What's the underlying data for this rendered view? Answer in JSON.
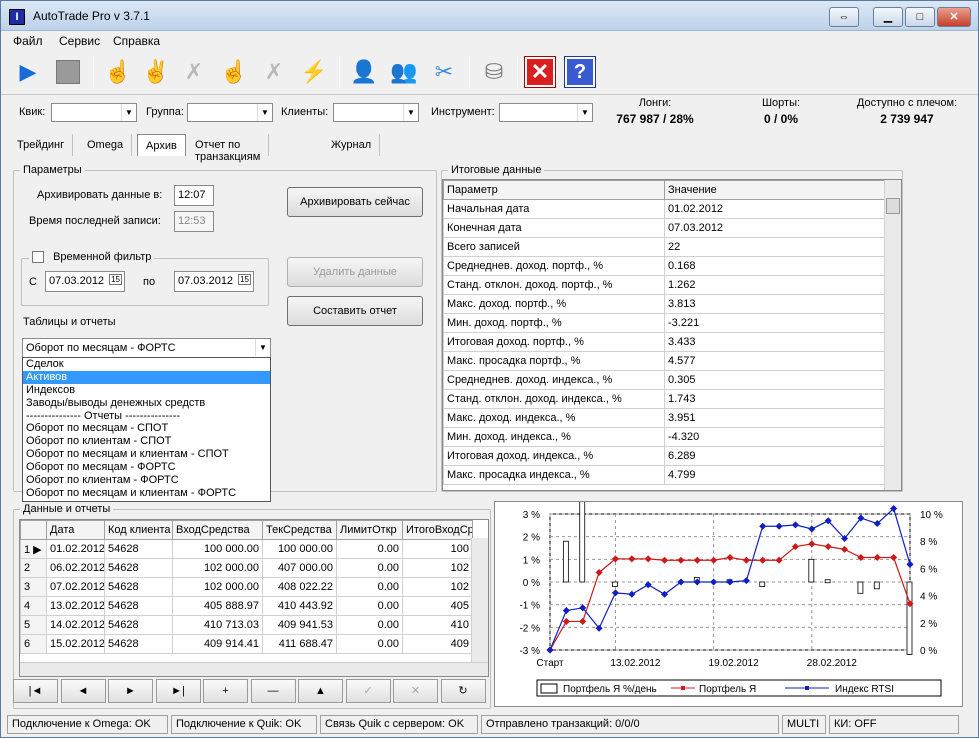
{
  "window": {
    "title": "AutoTrade Pro v 3.7.1"
  },
  "menu": [
    "Файл",
    "Сервис",
    "Справка"
  ],
  "filters": {
    "kvik": "Квик:",
    "gruppa": "Группа:",
    "klienty": "Клиенты:",
    "instrument": "Инструмент:"
  },
  "stats": {
    "longi_label": "Лонги:",
    "longi_value": "767 987 / 28%",
    "shorty_label": "Шорты:",
    "shorty_value": "0 / 0%",
    "dost_label": "Доступно с плечом:",
    "dost_value": "2 739 947"
  },
  "tabs": [
    "Трейдинг",
    "Omega",
    "Архив",
    "Отчет по транзакциям",
    "Журнал"
  ],
  "params": {
    "group": "Параметры",
    "archive_label": "Архивировать данные в:",
    "archive_time": "12:07",
    "last_label": "Время последней записи:",
    "last_time": "12:53",
    "archive_btn": "Архивировать сейчас",
    "time_filter": "Временной фильтр",
    "from_label": "С",
    "from_date": "07.03.2012",
    "to_label": "по",
    "to_date": "07.03.2012",
    "delete_btn": "Удалить данные",
    "report_btn": "Составить отчет",
    "tables_label": "Таблицы и отчеты",
    "selected": "Оборот по месяцам - ФОРТС"
  },
  "dropdown": [
    "Сделок",
    "Активов",
    "Индексов",
    "Заводы/выводы денежных средств",
    "--------------- Отчеты ---------------",
    "Оборот по месяцам - СПОТ",
    "Оборот по клиентам - СПОТ",
    "Оборот по месяцам и клиентам - СПОТ",
    "Оборот по месяцам - ФОРТС",
    "Оборот по клиентам - ФОРТС",
    "Оборот по месяцам и клиентам - ФОРТС"
  ],
  "summary": {
    "group": "Итоговые данные",
    "col_param": "Параметр",
    "col_value": "Значение",
    "rows": [
      [
        "Начальная дата",
        "01.02.2012"
      ],
      [
        "Конечная дата",
        "07.03.2012"
      ],
      [
        "Всего записей",
        "22"
      ],
      [
        "Среднеднев. доход. портф., %",
        "0.168"
      ],
      [
        "Станд. отклон. доход. портф., %",
        "1.262"
      ],
      [
        "Макс. доход. портф., %",
        "3.813"
      ],
      [
        "Мин. доход. портф., %",
        "-3.221"
      ],
      [
        "Итоговая доход. портф., %",
        "3.433"
      ],
      [
        "Макс. просадка портф., %",
        "4.577"
      ],
      [
        "Среднеднев. доход. индекса., %",
        "0.305"
      ],
      [
        "Станд. отклон. доход. индекса., %",
        "1.743"
      ],
      [
        "Макс. доход. индекса., %",
        "3.951"
      ],
      [
        "Мин. доход. индекса., %",
        "-4.320"
      ],
      [
        "Итоговая доход. индекса., %",
        "6.289"
      ],
      [
        "Макс. просадка индекса., %",
        "4.799"
      ]
    ]
  },
  "data_group": "Данные и отчеты",
  "data_table": {
    "headers": [
      "Дата",
      "Код клиента",
      "ВходСредства",
      "ТекСредства",
      "ЛимитОткр",
      "ИтогоВходСр"
    ],
    "rows": [
      [
        "1",
        "01.02.2012",
        "54628",
        "100 000.00",
        "100 000.00",
        "0.00",
        "100"
      ],
      [
        "2",
        "06.02.2012",
        "54628",
        "102 000.00",
        "407 000.00",
        "0.00",
        "102"
      ],
      [
        "3",
        "07.02.2012",
        "54628",
        "102 000.00",
        "408 022.22",
        "0.00",
        "102"
      ],
      [
        "4",
        "13.02.2012",
        "54628",
        "405 888.97",
        "410 443.92",
        "0.00",
        "405"
      ],
      [
        "5",
        "14.02.2012",
        "54628",
        "410 713.03",
        "409 941.53",
        "0.00",
        "410"
      ],
      [
        "6",
        "15.02.2012",
        "54628",
        "409 914.41",
        "411 688.47",
        "0.00",
        "409"
      ]
    ]
  },
  "nav": [
    "|◄",
    "◄",
    "►",
    "►|",
    "+",
    "—",
    "▲",
    "✓",
    "✕",
    "↻"
  ],
  "chart_data": {
    "type": "line",
    "x": [
      "Старт",
      "",
      "",
      "",
      "",
      "",
      "",
      "",
      "",
      "",
      "",
      "",
      "",
      "",
      "",
      "",
      "",
      "",
      "",
      "",
      "",
      "",
      ""
    ],
    "x_tick_labels": [
      "Старт",
      "13.02.2012",
      "19.02.2012",
      "28.02.2012"
    ],
    "left_axis": [
      "3 %",
      "2 %",
      "1 %",
      "0 %",
      "-1 %",
      "-2 %",
      "-3 %"
    ],
    "right_axis": [
      "10 %",
      "8 %",
      "6 %",
      "4 %",
      "2 %",
      "0 %"
    ],
    "series": [
      {
        "name": "Портфель Я %/день",
        "type": "bar",
        "values": [
          0,
          1.8,
          3.8,
          0,
          -0.2,
          0,
          0,
          0,
          0,
          0.2,
          0,
          0.1,
          0,
          -0.2,
          0,
          0,
          1,
          0.1,
          0,
          -0.5,
          -0.3,
          0,
          -3.2
        ]
      },
      {
        "name": "Портфель Я",
        "values": [
          0,
          2.1,
          2.1,
          5.7,
          6.7,
          6.7,
          6.7,
          6.6,
          6.6,
          6.6,
          6.6,
          6.8,
          6.6,
          6.6,
          6.6,
          7.6,
          7.8,
          7.6,
          7.4,
          6.8,
          6.8,
          6.8,
          3.4
        ]
      },
      {
        "name": "Индекс RTSI",
        "values": [
          0,
          2.9,
          3.1,
          1.6,
          4.2,
          4.1,
          4.8,
          4.1,
          5,
          5,
          5,
          5,
          5.1,
          9.1,
          9.1,
          9.2,
          8.9,
          9.5,
          8.2,
          9.7,
          9.3,
          10.4,
          6.3
        ]
      }
    ],
    "ylim_left": [
      -3,
      3
    ],
    "ylim_right": [
      0,
      10
    ]
  },
  "status": {
    "omega": "Подключение к Omega: OK",
    "quik": "Подключение к Quik: OK",
    "server": "Связь Quik с сервером: OK",
    "sent": "Отправлено транзакций: 0/0/0",
    "multi": "MULTI",
    "ki": "КИ: OFF"
  }
}
